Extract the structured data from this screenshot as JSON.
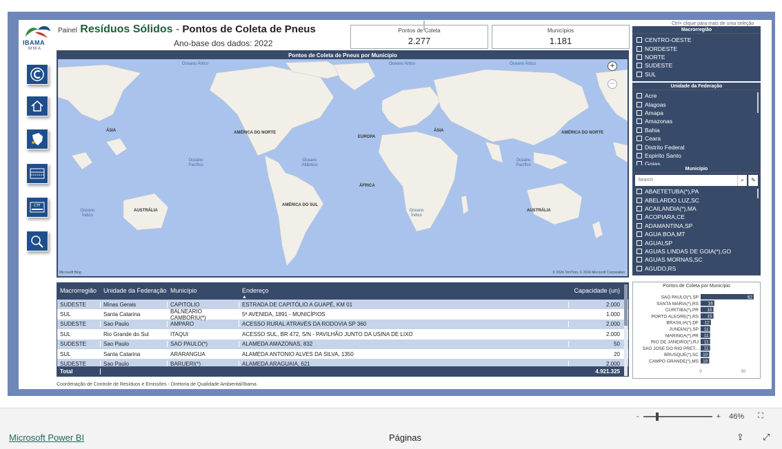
{
  "header": {
    "logo_text": "IBAMA",
    "logo_sub": "MMA",
    "painel_label": "Painel",
    "title_main": "Resíduos Sólidos",
    "title_sep": "-",
    "title_sub": "Pontos de Coleta de Pneus",
    "subtitle": "Ano-base dos dados: 2022"
  },
  "cards": {
    "pontos": {
      "label": "Pontos de Coleta",
      "value": "2.277"
    },
    "municipios": {
      "label": "Municípios",
      "value": "1.181"
    }
  },
  "ctrl_hint": "Ctrl+ clique para mais de uma seleção",
  "nav": [
    {
      "icon": "refresh-c-icon"
    },
    {
      "icon": "home-icon"
    },
    {
      "icon": "brazil-map-icon"
    },
    {
      "icon": "table-report-icon"
    },
    {
      "icon": "ctf-card-icon"
    },
    {
      "icon": "consulta-search-icon"
    }
  ],
  "map": {
    "title": "Pontos de Coleta de Pneus por Município",
    "labels": {
      "asia1": "ÁSIA",
      "na1": "AMÉRICA DO NORTE",
      "europa": "EUROPA",
      "asia2": "ÁSIA",
      "na2": "AMÉRICA DO NORTE",
      "africa": "ÁFRICA",
      "australia1": "AUSTRÁLIA",
      "sa": "AMÉRICA DO SUL",
      "australia2": "AUSTRÁLIA",
      "sa2": "AMÉRICA DO SUL"
    },
    "oceans": {
      "artico1": "Oceano Ártico",
      "artico2": "Oceano Ártico",
      "artico3": "Oceano Ártico",
      "pacifico1": "Oceano Pacífico",
      "atlantico1": "Oceano Atlântico",
      "pacifico2": "Oceano Pacífico",
      "indico1": "Oceano Índico",
      "indico2": "Oceano Índico"
    },
    "credit_left": "Microsoft Bing",
    "credit_right": "© 2024 TomTom, © 2024 Microsoft Corporation"
  },
  "slicers": {
    "macro": {
      "header": "Macrorregião",
      "items": [
        "CENTRO-OESTE",
        "NORDESTE",
        "NORTE",
        "SUDESTE",
        "SUL"
      ]
    },
    "uf": {
      "header": "Unidade da Federação",
      "items": [
        "Acre",
        "Alagoas",
        "Amapa",
        "Amazonas",
        "Bahia",
        "Ceara",
        "Distrito Federal",
        "Espirito Santo",
        "Goias"
      ]
    },
    "municipio": {
      "header": "Município",
      "search_placeholder": "Search",
      "items": [
        "ABAETETUBA(*),PA",
        "ABELARDO LUZ,SC",
        "ACAILANDIA(*),MA",
        "ACOPIARA,CE",
        "ADAMANTINA,SP",
        "AGUA BOA,MT",
        "AGUAI,SP",
        "AGUAS LINDAS DE GOIA(*),GO",
        "AGUAS MORNAS,SC",
        "AGUDO,RS"
      ]
    }
  },
  "table": {
    "columns": [
      "Macrorregião",
      "Unidade da Federação",
      "Município",
      "Endereço",
      "Capacidade (un)"
    ],
    "rows": [
      [
        "SUDESTE",
        "Minas Gerais",
        "CAPITOLIO",
        "ESTRADA DE CAPITÓLIO A GUAPÉ, KM 01",
        "2.000"
      ],
      [
        "SUL",
        "Santa Catarina",
        "BALNEARIO CAMBORIU(*)",
        "5ª AVENIDA, 1891 - MUNICÍPIOS",
        "1.000"
      ],
      [
        "SUDESTE",
        "Sao Paulo",
        "AMPARO",
        "ACESSO RURAL ATRAVÉS DA RODOVIA SP 360",
        "2.000"
      ],
      [
        "SUL",
        "Rio Grande do Sul",
        "ITAQUI",
        "ACESSO SUL, BR 472, S/N - PAVILHÃO JUNTO DA USINA DE LIXO",
        "2.000"
      ],
      [
        "SUDESTE",
        "Sao Paulo",
        "SAO PAULO(*)",
        "ALAMEDA AMAZONAS, 832",
        "50"
      ],
      [
        "SUL",
        "Santa Catarina",
        "ARARANGUA",
        "ALAMEDA ANTONIO ALVES DA SILVA, 1350",
        "20"
      ],
      [
        "SUDESTE",
        "Sao Paulo",
        "BARUERI(*)",
        "ALAMEDA ARAGUAIA, 621",
        "2.000"
      ]
    ],
    "total_label": "Total",
    "total_value": "4.921.325"
  },
  "chart_data": {
    "type": "bar",
    "title": "Pontos de Coleta por Município",
    "categories": [
      "SAO PAULO(*),SP",
      "SANTA MARIA(*),RS",
      "CURITIBA(*),PR",
      "PORTO ALEGRE(*),RS",
      "BRASILIA(*),DF",
      "JUNDIAI(*),SP",
      "MARINGA(*),PR",
      "RIO DE JANEIRO(*),RJ",
      "SAO JOSE DO RIO PRET...",
      "BRUSQUE(*),SC",
      "CAMPO GRANDE(*),MS"
    ],
    "values": [
      62,
      16,
      15,
      15,
      12,
      11,
      11,
      11,
      11,
      10,
      10
    ],
    "xlim": [
      0,
      62
    ],
    "xticks": [
      "0",
      "50"
    ],
    "bar_color": "#374a69"
  },
  "footer_note": "Coordenação de Controle de Resíduos e Emissões - Diretoria de Qualidade Ambiental/Ibama",
  "pbi": {
    "zoom_minus": "-",
    "zoom_plus": "+",
    "zoom_pct": "46%",
    "link": "Microsoft Power BI",
    "pages": "Páginas"
  }
}
